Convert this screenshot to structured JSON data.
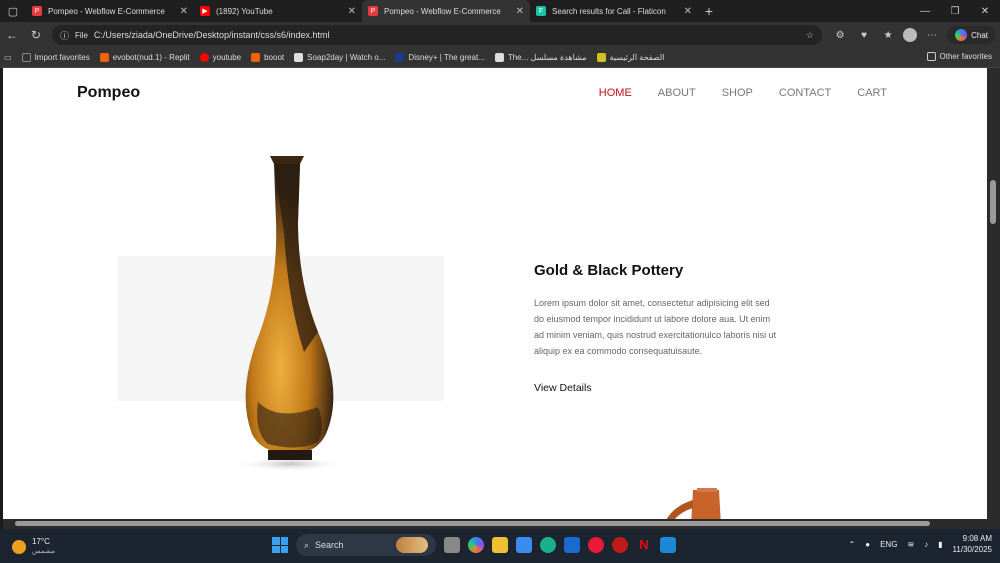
{
  "browser": {
    "tabs": [
      {
        "title": "Pompeo - Webflow E-Commerce",
        "fav_color": "#e83a3a",
        "active": false
      },
      {
        "title": "(1892) YouTube",
        "fav_color": "#ff0000",
        "active": false
      },
      {
        "title": "Pompeo - Webflow E-Commerce",
        "fav_color": "#e83a3a",
        "active": true
      },
      {
        "title": "Search results for Call - Flaticon",
        "fav_color": "#17c3a5",
        "active": false
      }
    ],
    "address": {
      "scheme_label": "File",
      "url": "C:/Users/ziada/OneDrive/Desktop/instant/css/s6/index.html"
    },
    "chat_label": "Chat",
    "bookmarks": [
      {
        "label": "Import favorites",
        "color": "#888888"
      },
      {
        "label": "evobot(nud.1) - Replit",
        "color": "#f26207"
      },
      {
        "label": "youtube",
        "color": "#ff0000"
      },
      {
        "label": "booot",
        "color": "#f26207"
      },
      {
        "label": "Soap2day | Watch o...",
        "color": "#dddddd"
      },
      {
        "label": "Disney+ | The great...",
        "color": "#1a3c8a"
      },
      {
        "label": "The... مشاهدة مسلسل",
        "color": "#dddddd"
      },
      {
        "label": "الصفحة الرئيسية",
        "color": "#d0c020"
      }
    ],
    "other_favorites": "Other favorites"
  },
  "site": {
    "brand": "Pompeo",
    "nav": [
      "HOME",
      "ABOUT",
      "SHOP",
      "CONTACT",
      "CART"
    ],
    "accent": "#c0101a",
    "product": {
      "title": "Gold & Black Pottery",
      "description": "Lorem ipsum dolor sit amet, consectetur adipisicing elit sed do eiusmod tempor incididunt ut labore dolore aua. Ut enim ad minim veniam, quis nostrud exercitationulco laboris nisi ut aliquip ex ea commodo consequatuisaute.",
      "link": "View Details"
    }
  },
  "taskbar": {
    "weather_temp": "17°C",
    "weather_desc": "مشمس",
    "search_label": "Search",
    "lang": "ENG",
    "time": "9:08 AM",
    "date": "11/30/2025"
  }
}
